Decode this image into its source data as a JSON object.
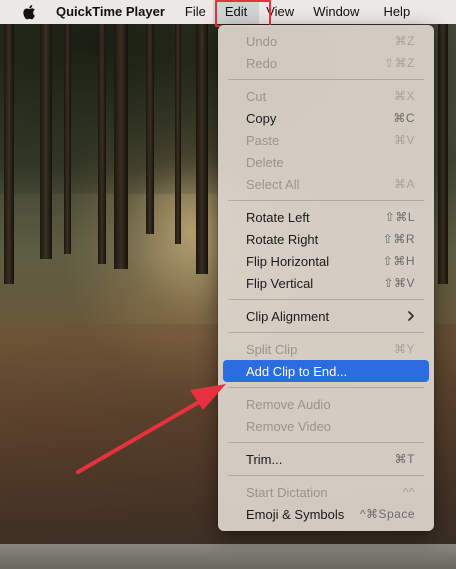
{
  "menubar": {
    "app_name": "QuickTime Player",
    "items": [
      "File",
      "Edit",
      "View",
      "Window",
      "Help"
    ]
  },
  "edit_menu": {
    "groups": [
      [
        {
          "label": "Undo",
          "shortcut": "⌘Z",
          "enabled": false
        },
        {
          "label": "Redo",
          "shortcut": "⇧⌘Z",
          "enabled": false
        }
      ],
      [
        {
          "label": "Cut",
          "shortcut": "⌘X",
          "enabled": false
        },
        {
          "label": "Copy",
          "shortcut": "⌘C",
          "enabled": true
        },
        {
          "label": "Paste",
          "shortcut": "⌘V",
          "enabled": false
        },
        {
          "label": "Delete",
          "shortcut": "",
          "enabled": false
        },
        {
          "label": "Select All",
          "shortcut": "⌘A",
          "enabled": false
        }
      ],
      [
        {
          "label": "Rotate Left",
          "shortcut": "⇧⌘L",
          "enabled": true
        },
        {
          "label": "Rotate Right",
          "shortcut": "⇧⌘R",
          "enabled": true
        },
        {
          "label": "Flip Horizontal",
          "shortcut": "⇧⌘H",
          "enabled": true
        },
        {
          "label": "Flip Vertical",
          "shortcut": "⇧⌘V",
          "enabled": true
        }
      ],
      [
        {
          "label": "Clip Alignment",
          "shortcut": "",
          "enabled": true,
          "submenu": true
        }
      ],
      [
        {
          "label": "Split Clip",
          "shortcut": "⌘Y",
          "enabled": false
        },
        {
          "label": "Add Clip to End...",
          "shortcut": "",
          "enabled": true,
          "selected": true
        }
      ],
      [
        {
          "label": "Remove Audio",
          "shortcut": "",
          "enabled": false
        },
        {
          "label": "Remove Video",
          "shortcut": "",
          "enabled": false
        }
      ],
      [
        {
          "label": "Trim...",
          "shortcut": "⌘T",
          "enabled": true
        }
      ],
      [
        {
          "label": "Start Dictation",
          "shortcut": "^^",
          "enabled": false
        },
        {
          "label": "Emoji & Symbols",
          "shortcut": "^⌘Space",
          "enabled": true
        }
      ]
    ]
  },
  "colors": {
    "selection": "#2b6de0",
    "annotation": "#e8313f"
  },
  "icons": {
    "apple": "apple-icon",
    "submenu": "chevron-right-icon"
  }
}
